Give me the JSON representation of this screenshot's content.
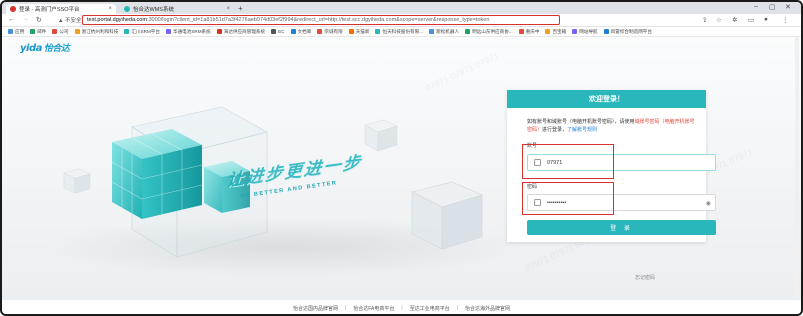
{
  "browser": {
    "tabs": [
      {
        "title": "登录 - 高测门户SSO平台",
        "active": true,
        "color": "#d9302c"
      },
      {
        "title": "怡合达WMS系统",
        "active": false,
        "color": "#2ab7bc"
      }
    ],
    "new_tab": "+",
    "security_label": "不安全",
    "url_host": "test.portal.dgyiheda.com",
    "url_rest": ":3000/login?client_id=1a81b51d7a3f4276aeb974d03ef2f994&redirect_url=http://test.scc.dgyiheda.com&scope=server&response_type=token",
    "bookmarks": [
      "应用",
      "邮件",
      "公司",
      "浙江杭州利和科技",
      "汇川SRM平台",
      "华通电池SRM系统",
      "海达供应商管理系统",
      "EC",
      "文档库",
      "宗诚有限",
      "天猫新",
      "恒天科技股份有限...",
      "新松机器人",
      "明远山东供应商协...",
      "重庆中",
      "百宝箱",
      "网站导航",
      "风雷综合制造网平台"
    ]
  },
  "page": {
    "logo_text": "yida",
    "logo_cn": "怡合达",
    "slogan": "让进步更进一步",
    "slogan_en": "BE BETTER AND BETTER",
    "login": {
      "title": "欢迎登录！",
      "notice_prefix": "如有账号和域账号（电脑开机账号密码），请使用",
      "notice_highlight": "域账号密码（电脑开机账号密码）",
      "notice_mid": "进行登录，",
      "notice_link": "了解账号规则",
      "username_label": "账号",
      "username_value": "07971",
      "password_label": "密码",
      "password_value": "••••••••••",
      "submit_label": "登 录",
      "forgot_label": "忘记密码"
    },
    "footer_links": [
      "怡合达国内品牌官网",
      "怡合达FA电商平台",
      "至达工业电商平台",
      "怡合达海外品牌官网"
    ]
  },
  "colors": {
    "accent": "#2ab7bc",
    "highlight_box": "#d9302c"
  }
}
